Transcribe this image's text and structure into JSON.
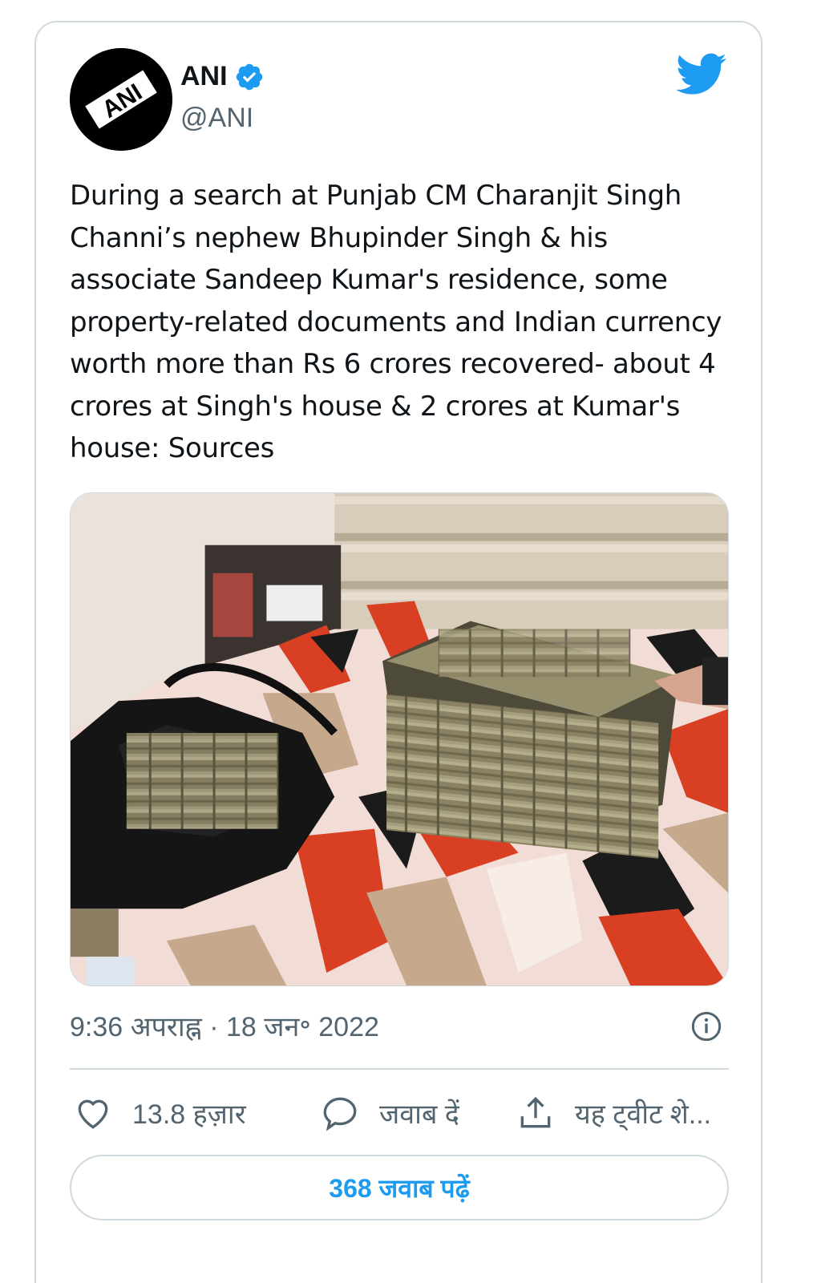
{
  "author": {
    "name": "ANI",
    "handle": "@ANI",
    "avatar_text": "ANI",
    "verified": true,
    "verified_icon": "verified-badge-icon"
  },
  "platform_icon": "twitter-bird-icon",
  "tweet": {
    "text": "During a search at Punjab CM Charanjit Singh Channi’s nephew Bhupinder Singh & his associate Sandeep Kumar's residence, some property-related documents and Indian currency worth more than Rs 6 crores recovered- about 4 crores at Singh's house & 2 crores at Kumar's house: Sources",
    "timestamp": "9:36 अपराह्न · 18 जन॰ 2022"
  },
  "actions": {
    "like_count": "13.8 हज़ार",
    "reply_label": "जवाब दें",
    "share_label": "यह ट्वीट शे..."
  },
  "read_replies_label": "368 जवाब पढ़ें",
  "colors": {
    "accent": "#1d9bf0",
    "text": "#0f1419",
    "muted": "#536471",
    "border": "#cfd9de"
  }
}
